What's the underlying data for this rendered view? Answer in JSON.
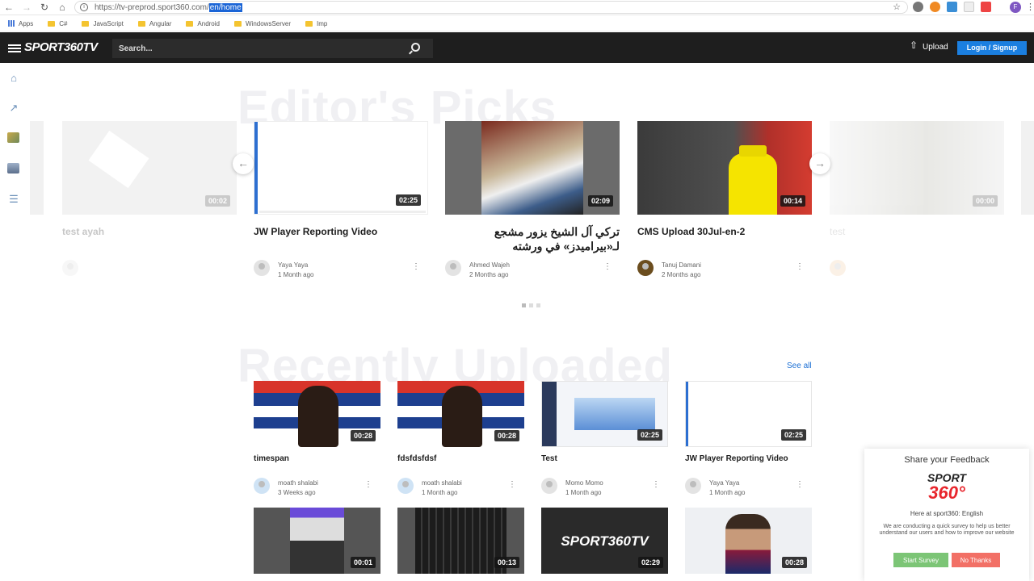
{
  "browser": {
    "url_host": "https://tv-preprod.sport360.com/",
    "url_path": "en/home",
    "bookmarks": [
      "Apps",
      "C#",
      "JavaScript",
      "Angular",
      "Android",
      "WindowsServer",
      "Imp"
    ],
    "profile_initial": "F"
  },
  "header": {
    "logo_text": "SPORT360TV",
    "search_placeholder": "Search...",
    "upload_label": "Upload",
    "login_label": "Login / Signup"
  },
  "sidebar": {
    "icons": [
      "home-icon",
      "trending-icon",
      "category-thumb-1",
      "category-thumb-2",
      "list-icon"
    ]
  },
  "editors_picks": {
    "watermark": "Editor's Picks",
    "cards": [
      {
        "title": "test ayah",
        "duration": "00:02",
        "author": "",
        "time": "",
        "faded": true
      },
      {
        "title": "JW Player Reporting Video",
        "duration": "02:25",
        "author": "Yaya Yaya",
        "time": "1 Month ago"
      },
      {
        "title": "تركي آل الشيخ يزور مشجع لـ«بيراميدز» في ورشته",
        "duration": "02:09",
        "author": "Ahmed Wajeh",
        "time": "2 Months ago"
      },
      {
        "title": "CMS Upload 30Jul-en-2",
        "duration": "00:14",
        "author": "Tanuj Damani",
        "time": "2 Months ago"
      },
      {
        "title": "test",
        "duration": "00:00",
        "author": "",
        "time": "",
        "faded": true
      }
    ]
  },
  "recently_uploaded": {
    "watermark": "Recently Uploaded",
    "see_all": "See all",
    "cards": [
      {
        "title": "timespan",
        "duration": "00:28",
        "author": "moath shalabi",
        "time": "3 Weeks ago"
      },
      {
        "title": "fdsfdsfdsf",
        "duration": "00:28",
        "author": "moath shalabi",
        "time": "1 Month ago"
      },
      {
        "title": "Test",
        "duration": "02:25",
        "author": "Momo Momo",
        "time": "1 Month ago"
      },
      {
        "title": "JW Player Reporting Video",
        "duration": "02:25",
        "author": "Yaya Yaya",
        "time": "1 Month ago"
      },
      {
        "title": "",
        "duration": "00:01"
      },
      {
        "title": "",
        "duration": "00:13"
      },
      {
        "title": "",
        "duration": "02:29",
        "overlay_text": "SPORT360TV"
      },
      {
        "title": "",
        "duration": "00:28"
      }
    ]
  },
  "feedback": {
    "title": "Share your Feedback",
    "logo_top": "SPORT",
    "logo_num": "360°",
    "here": "Here at sport360: English",
    "description": "We are conducting a quick survey to help us better understand our users and how to improve our website",
    "start_label": "Start Survey",
    "no_label": "No Thanks"
  },
  "colors": {
    "header_bg": "#1e1e1e",
    "accent_blue": "#1b7fe0",
    "survey_green": "#7cc576",
    "survey_red": "#f27066"
  }
}
